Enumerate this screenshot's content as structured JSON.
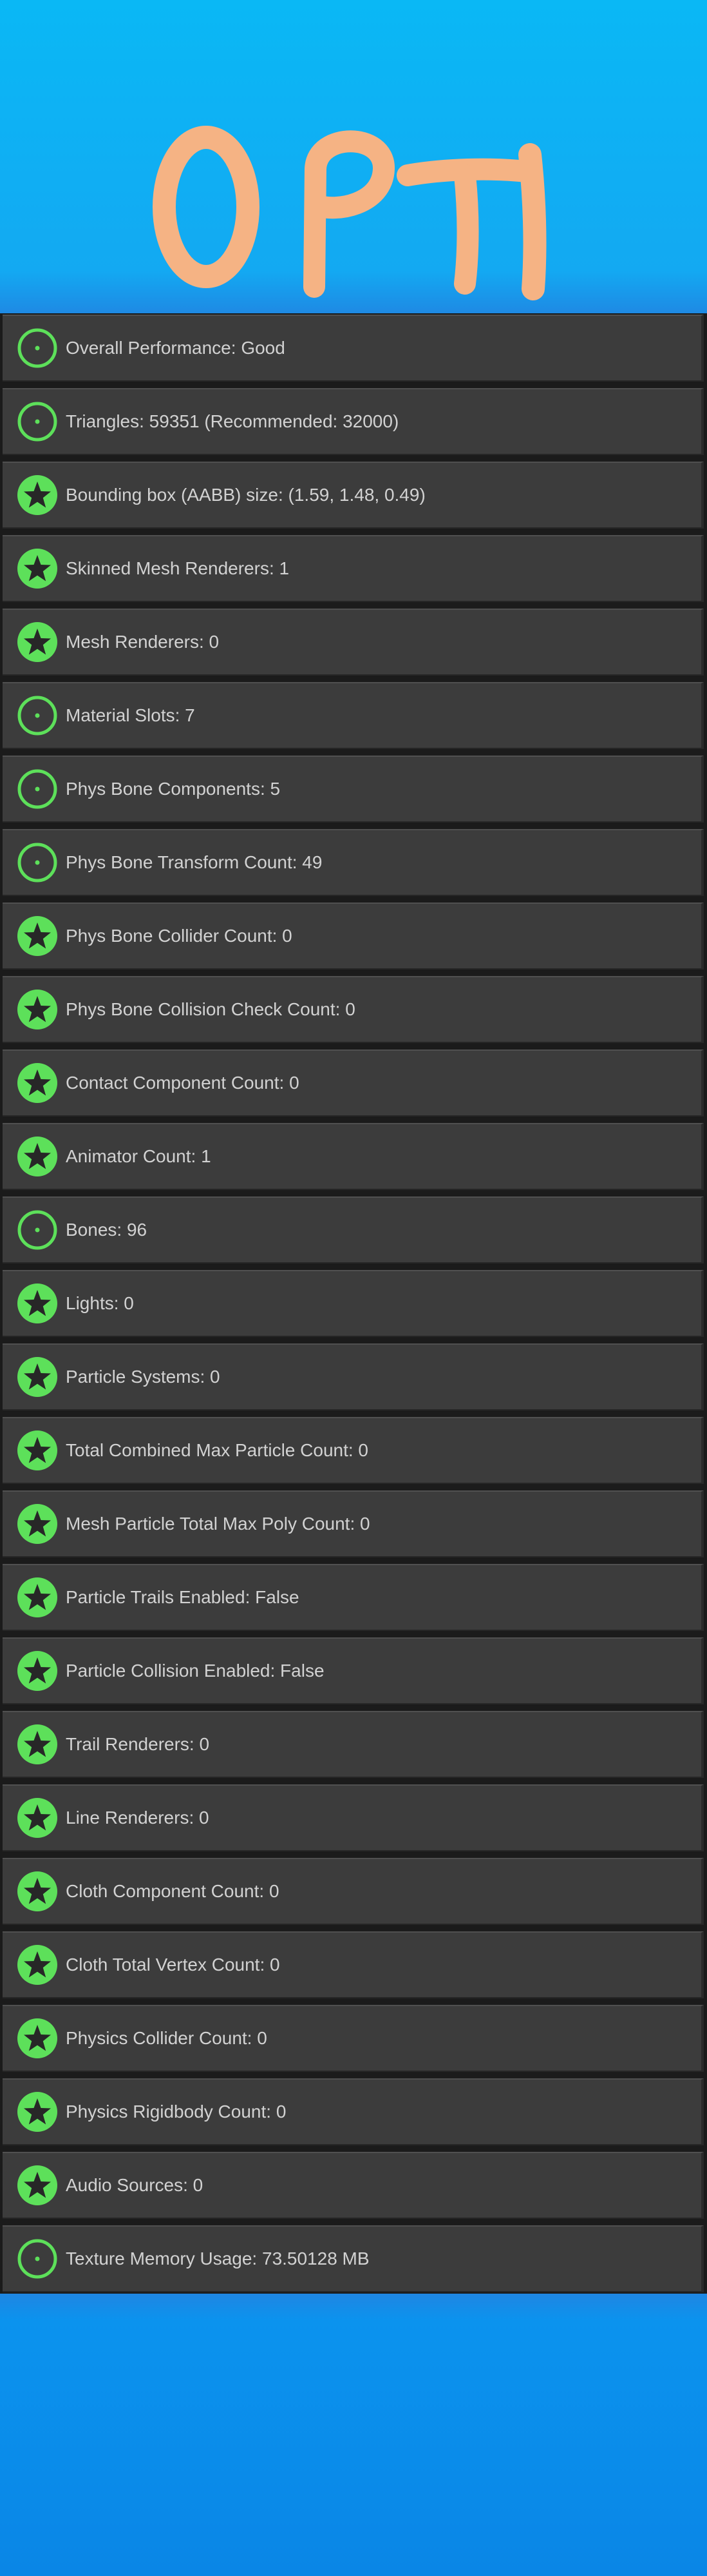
{
  "header": {
    "logo_text": "OPTI",
    "logo_color": "#f5b384"
  },
  "colors": {
    "good_green": "#5de05a",
    "row_bg": "#3c3c3c",
    "label_text": "#d2d2d2"
  },
  "stats": [
    {
      "label": "Overall Performance: Good",
      "icon": "good-circle-icon"
    },
    {
      "label": "Triangles: 59351 (Recommended: 32000)",
      "icon": "good-circle-icon"
    },
    {
      "label": "Bounding box (AABB) size: (1.59, 1.48, 0.49)",
      "icon": "excellent-star-icon"
    },
    {
      "label": "Skinned Mesh Renderers: 1",
      "icon": "excellent-star-icon"
    },
    {
      "label": "Mesh Renderers: 0",
      "icon": "excellent-star-icon"
    },
    {
      "label": "Material Slots: 7",
      "icon": "good-circle-icon"
    },
    {
      "label": "Phys Bone Components: 5",
      "icon": "good-circle-icon"
    },
    {
      "label": "Phys Bone Transform Count: 49",
      "icon": "good-circle-icon"
    },
    {
      "label": "Phys Bone Collider Count: 0",
      "icon": "excellent-star-icon"
    },
    {
      "label": "Phys Bone Collision Check Count: 0",
      "icon": "excellent-star-icon"
    },
    {
      "label": "Contact Component Count: 0",
      "icon": "excellent-star-icon"
    },
    {
      "label": "Animator Count: 1",
      "icon": "excellent-star-icon"
    },
    {
      "label": "Bones: 96",
      "icon": "good-circle-icon"
    },
    {
      "label": "Lights: 0",
      "icon": "excellent-star-icon"
    },
    {
      "label": "Particle Systems: 0",
      "icon": "excellent-star-icon"
    },
    {
      "label": "Total Combined Max Particle Count: 0",
      "icon": "excellent-star-icon"
    },
    {
      "label": "Mesh Particle Total Max Poly Count: 0",
      "icon": "excellent-star-icon"
    },
    {
      "label": "Particle Trails Enabled: False",
      "icon": "excellent-star-icon"
    },
    {
      "label": "Particle Collision Enabled: False",
      "icon": "excellent-star-icon"
    },
    {
      "label": "Trail Renderers: 0",
      "icon": "excellent-star-icon"
    },
    {
      "label": "Line Renderers: 0",
      "icon": "excellent-star-icon"
    },
    {
      "label": "Cloth Component Count: 0",
      "icon": "excellent-star-icon"
    },
    {
      "label": "Cloth Total Vertex Count: 0",
      "icon": "excellent-star-icon"
    },
    {
      "label": "Physics Collider Count: 0",
      "icon": "excellent-star-icon"
    },
    {
      "label": "Physics Rigidbody Count: 0",
      "icon": "excellent-star-icon"
    },
    {
      "label": "Audio Sources: 0",
      "icon": "excellent-star-icon"
    },
    {
      "label": "Texture Memory Usage: 73.50128 MB",
      "icon": "good-circle-icon"
    }
  ]
}
